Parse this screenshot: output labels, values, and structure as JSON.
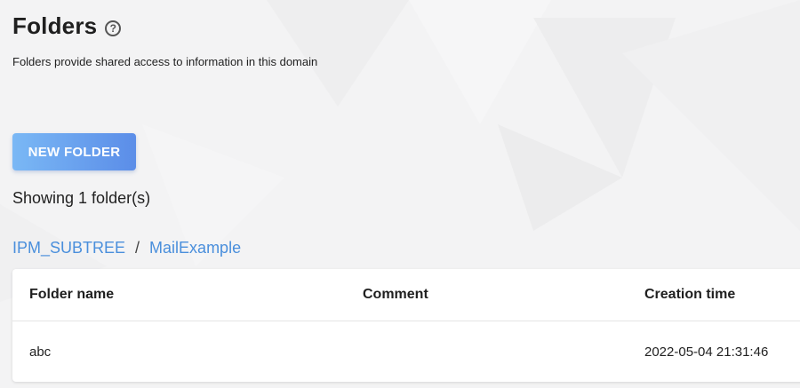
{
  "page": {
    "title": "Folders",
    "help_icon": "question-circle-icon",
    "subtitle": "Folders provide shared access to information in this domain"
  },
  "toolbar": {
    "new_folder_label": "NEW FOLDER",
    "accent_gradient": [
      "#7ab8f5",
      "#5b8de8"
    ]
  },
  "summary": {
    "showing_text": "Showing 1 folder(s)"
  },
  "breadcrumb": {
    "items": [
      "IPM_SUBTREE",
      "MailExample"
    ],
    "separator": "/",
    "link_color": "#4a8fdc"
  },
  "table": {
    "columns": [
      "Folder name",
      "Comment",
      "Creation time"
    ],
    "rows": [
      {
        "folder_name": "abc",
        "comment": "",
        "creation_time": "2022-05-04 21:31:46"
      }
    ]
  }
}
